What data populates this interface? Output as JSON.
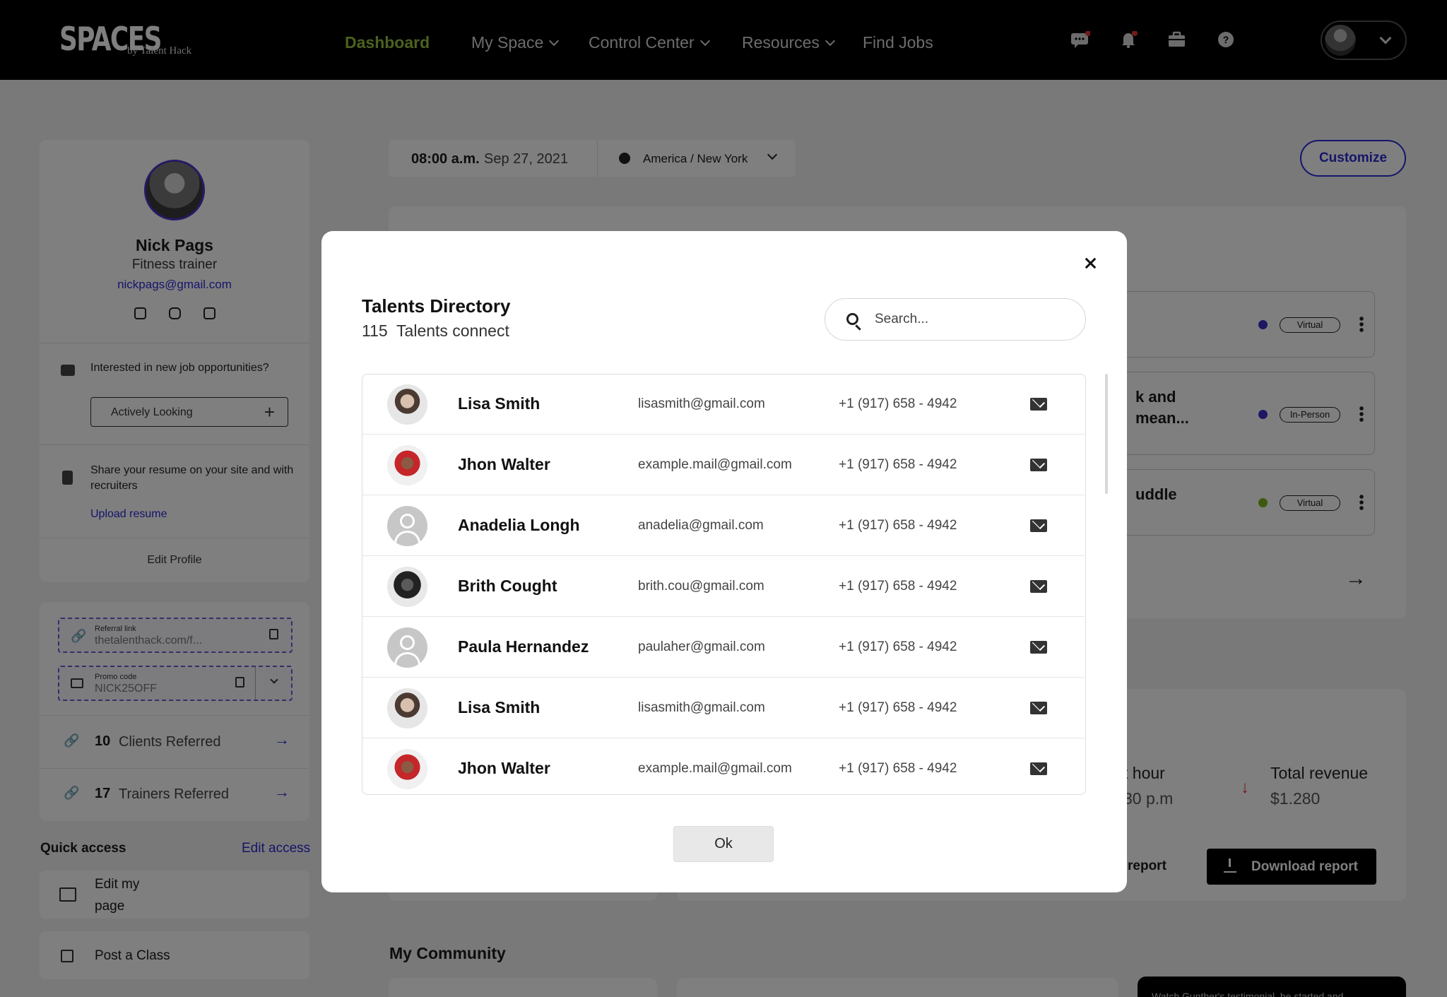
{
  "brand": {
    "logo": "SPACES",
    "sub": "by Talent Hack"
  },
  "nav": {
    "items": [
      {
        "label": "Dashboard",
        "active": true
      },
      {
        "label": "My Space"
      },
      {
        "label": "Control Center"
      },
      {
        "label": "Resources"
      },
      {
        "label": "Find Jobs"
      }
    ]
  },
  "topbar_icons": [
    "chat-icon",
    "bell-icon",
    "briefcase-icon",
    "help-icon"
  ],
  "profile": {
    "name": "Nick Pags",
    "role": "Fitness trainer",
    "email": "nickpags@gmail.com",
    "job_question": "Interested in new job opportunities?",
    "job_status": "Actively Looking",
    "resume_text": "Share your resume on your site and with recruiters",
    "upload_label": "Upload resume",
    "edit_label": "Edit Profile"
  },
  "referral": {
    "link_label": "Referral link",
    "link_value": "thetalenthack.com/f...",
    "promo_label": "Promo code",
    "promo_value": "NICK25OFF",
    "clients_count": "10",
    "clients_label": "Clients Referred",
    "trainers_count": "17",
    "trainers_label": "Trainers Referred"
  },
  "quick_access": {
    "title": "Quick access",
    "edit": "Edit access",
    "items": [
      "Edit my page",
      "Post a Class"
    ]
  },
  "time": {
    "clock": "08:00 a.m.",
    "date": "Sep 27, 2021",
    "timezone": "America / New York"
  },
  "customize_label": "Customize",
  "events": [
    {
      "title_fragment": "",
      "tag": "Virtual",
      "dot_color": "#3b2fc9"
    },
    {
      "title_fragment": "k and\nmean...",
      "tag": "In-Person",
      "dot_color": "#3b2fc9"
    },
    {
      "title_fragment": "uddle",
      "tag": "Virtual",
      "dot_color": "#7ab51d"
    }
  ],
  "stats": {
    "hour_label_fragment": "t hour",
    "hour_value_fragment": "30 p.m",
    "revenue_label": "Total revenue",
    "revenue_value": "$1.280",
    "report_fragment": "report",
    "download_label": "Download report"
  },
  "community_title": "My Community",
  "testimonial_fragment": "Watch Gunther's testimonial, he started and...",
  "modal": {
    "title": "Talents Directory",
    "count": "115",
    "count_label": "Talents connect",
    "search_placeholder": "Search...",
    "ok_label": "Ok",
    "talents": [
      {
        "name": "Lisa Smith",
        "email": "lisasmith@gmail.com",
        "phone": "+1 (917) 658 - 4942",
        "avatar": "photo-a"
      },
      {
        "name": "Jhon Walter",
        "email": "example.mail@gmail.com",
        "phone": "+1 (917) 658 - 4942",
        "avatar": "photo-b"
      },
      {
        "name": "Anadelia Longh",
        "email": "anadelia@gmail.com",
        "phone": "+1 (917) 658 - 4942",
        "avatar": "default"
      },
      {
        "name": "Brith Cought",
        "email": "brith.cou@gmail.com",
        "phone": "+1 (917) 658 - 4942",
        "avatar": "photo-c"
      },
      {
        "name": "Paula Hernandez",
        "email": "paulaher@gmail.com",
        "phone": "+1 (917) 658 - 4942",
        "avatar": "default"
      },
      {
        "name": "Lisa Smith",
        "email": "lisasmith@gmail.com",
        "phone": "+1 (917) 658 - 4942",
        "avatar": "photo-a"
      },
      {
        "name": "Jhon Walter",
        "email": "example.mail@gmail.com",
        "phone": "+1 (917) 658 - 4942",
        "avatar": "photo-b"
      }
    ]
  }
}
